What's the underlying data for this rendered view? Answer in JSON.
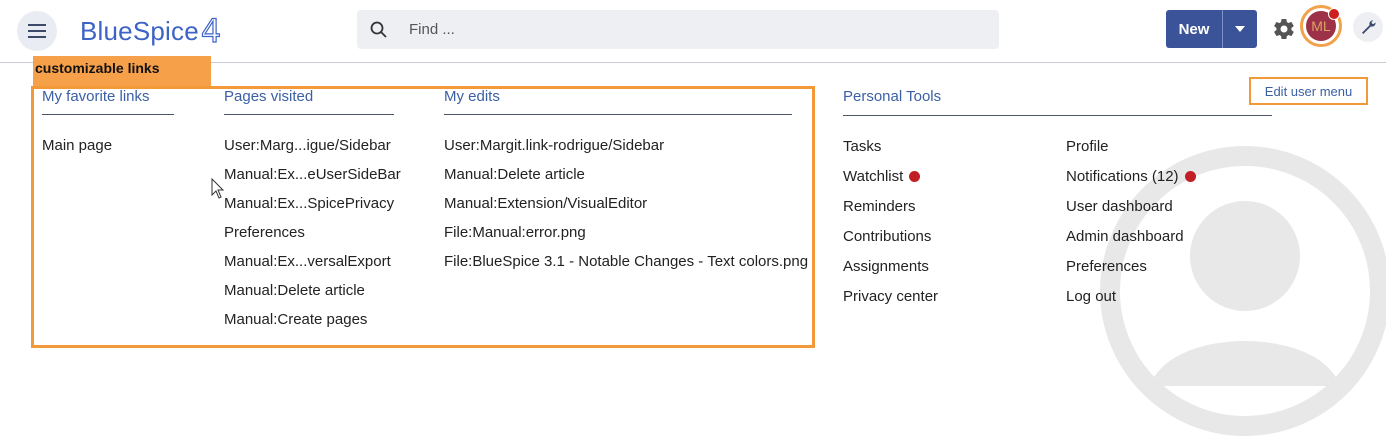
{
  "header": {
    "logo_text": "BlueSpice",
    "logo_number": "4",
    "search_placeholder": "Find ...",
    "new_label": "New",
    "avatar_initials": "ML",
    "icons": [
      "menu-icon",
      "search-icon",
      "chevron-down-icon",
      "gear-icon",
      "avatar",
      "wrench-icon"
    ]
  },
  "annotation": {
    "badge": "customizable links"
  },
  "columns": {
    "favorites": {
      "title": "My favorite links",
      "items": [
        "Main page"
      ]
    },
    "visited": {
      "title": "Pages visited",
      "items": [
        "User:Marg...igue/Sidebar",
        "Manual:Ex...eUserSideBar",
        "Manual:Ex...SpicePrivacy",
        "Preferences",
        "Manual:Ex...versalExport",
        "Manual:Delete article",
        "Manual:Create pages"
      ]
    },
    "edits": {
      "title": "My edits",
      "items": [
        "User:Margit.link-rodrigue/Sidebar",
        "Manual:Delete article",
        "Manual:Extension/VisualEditor",
        "File:Manual:error.png",
        "File:BlueSpice 3.1 - Notable Changes - Text colors.png"
      ]
    }
  },
  "personal_tools": {
    "title": "Personal Tools",
    "edit_menu": "Edit user menu",
    "left": [
      "Tasks",
      "Watchlist",
      "Reminders",
      "Contributions",
      "Assignments",
      "Privacy center"
    ],
    "right": [
      "Profile",
      "Notifications (12)",
      "User dashboard",
      "Admin dashboard",
      "Preferences",
      "Log out"
    ]
  },
  "colors": {
    "accent": "#3b5499",
    "link": "#3b5fa3",
    "highlight": "#f29a39",
    "alert": "#c21f24"
  }
}
